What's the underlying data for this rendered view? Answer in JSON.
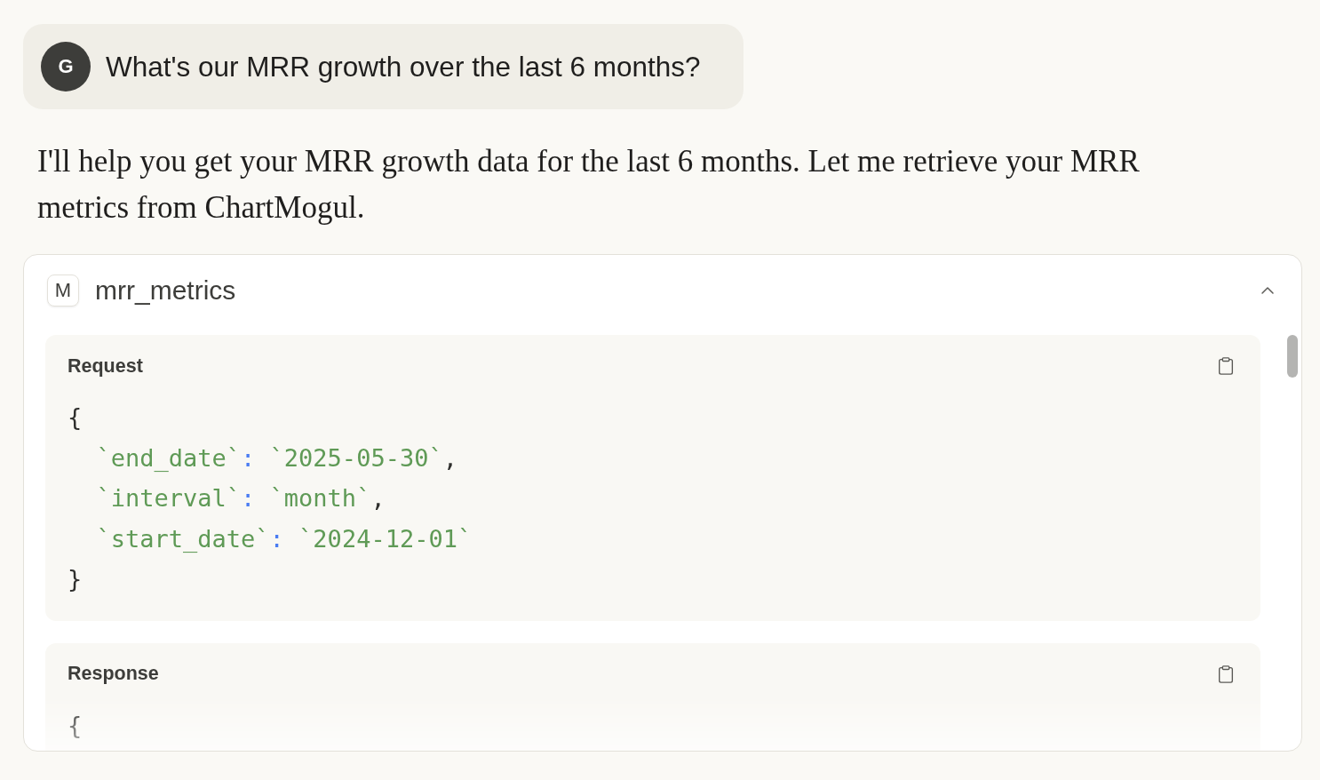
{
  "user_message": {
    "avatar": "G",
    "text": "What's our MRR growth over the last 6 months?"
  },
  "assistant_message": {
    "text": "I'll help you get your MRR growth data for the last 6 months. Let me retrieve your MRR metrics from ChartMogul."
  },
  "tool_call": {
    "initial": "M",
    "name": "mrr_metrics",
    "expanded": true,
    "sections": [
      {
        "title": "Request",
        "code": {
          "open": "{",
          "entries": [
            {
              "key": "`end_date`",
              "colon": ":",
              "value": "`2025-05-30`",
              "comma": ","
            },
            {
              "key": "`interval`",
              "colon": ":",
              "value": "`month`",
              "comma": ","
            },
            {
              "key": "`start_date`",
              "colon": ":",
              "value": "`2024-12-01`"
            }
          ],
          "close": "}"
        }
      },
      {
        "title": "Response",
        "code": {
          "open": "{"
        }
      }
    ]
  }
}
